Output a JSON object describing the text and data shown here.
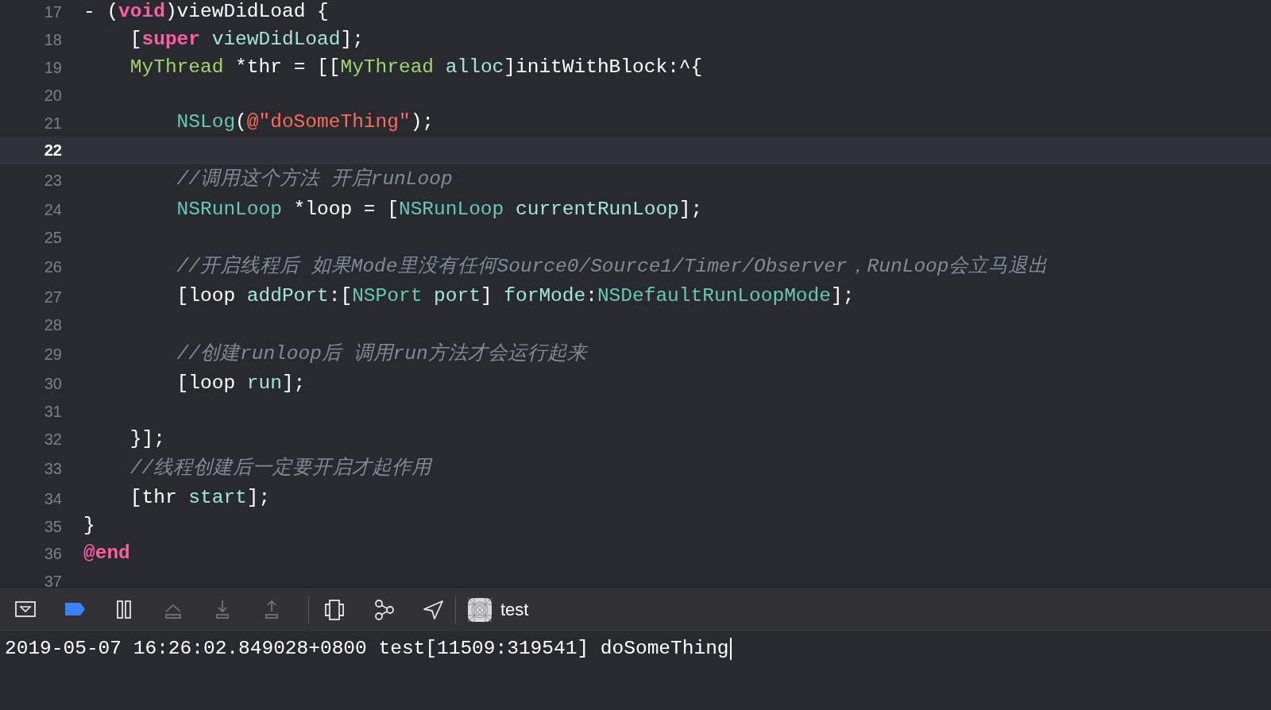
{
  "editor": {
    "lines": [
      {
        "number": "17",
        "current": false,
        "tokens": [
          {
            "text": "- (",
            "kind": "plain"
          },
          {
            "text": "void",
            "kind": "keyword"
          },
          {
            "text": ")viewDidLoad {",
            "kind": "plain"
          }
        ],
        "children": [
          {
            "number": "18",
            "current": false,
            "tokens": [
              {
                "text": "[",
                "kind": "plain"
              },
              {
                "text": "super",
                "kind": "keyword"
              },
              {
                "text": " viewDidLoad",
                "kind": "method"
              },
              {
                "text": "];",
                "kind": "plain"
              }
            ]
          },
          {
            "number": "19",
            "current": false,
            "tokens": [
              {
                "text": "MyThread",
                "kind": "class"
              },
              {
                "text": " *thr = [[",
                "kind": "plain"
              },
              {
                "text": "MyThread",
                "kind": "class"
              },
              {
                "text": " alloc",
                "kind": "method"
              },
              {
                "text": "]initWithBlock:^{",
                "kind": "plain"
              }
            ],
            "children": [
              {
                "number": "20",
                "current": false
              },
              {
                "number": "21",
                "current": false,
                "tokens": [
                  {
                    "text": "NSLog",
                    "kind": "system"
                  },
                  {
                    "text": "(",
                    "kind": "plain"
                  },
                  {
                    "text": "@\"doSomeThing\"",
                    "kind": "string"
                  },
                  {
                    "text": ");",
                    "kind": "plain"
                  }
                ]
              },
              {
                "number": "22",
                "current": true
              },
              {
                "number": "23",
                "current": false,
                "tokens": [
                  {
                    "text": "//调用这个方法 开启runLoop",
                    "kind": "comment"
                  }
                ]
              },
              {
                "number": "24",
                "current": false,
                "tokens": [
                  {
                    "text": "NSRunLoop",
                    "kind": "system"
                  },
                  {
                    "text": " *loop = [",
                    "kind": "plain"
                  },
                  {
                    "text": "NSRunLoop",
                    "kind": "system"
                  },
                  {
                    "text": " currentRunLoop",
                    "kind": "method"
                  },
                  {
                    "text": "];",
                    "kind": "plain"
                  }
                ]
              },
              {
                "number": "25",
                "current": false
              },
              {
                "number": "26",
                "current": false,
                "tokens": [
                  {
                    "text": "//开启线程后 如果Mode里没有任何Source0/Source1/Timer/Observer，RunLoop会立马退出",
                    "kind": "comment"
                  }
                ]
              },
              {
                "number": "27",
                "current": false,
                "tokens": [
                  {
                    "text": "[loop ",
                    "kind": "plain"
                  },
                  {
                    "text": "addPort",
                    "kind": "method"
                  },
                  {
                    "text": ":[",
                    "kind": "plain"
                  },
                  {
                    "text": "NSPort",
                    "kind": "system"
                  },
                  {
                    "text": " port",
                    "kind": "method"
                  },
                  {
                    "text": "] ",
                    "kind": "plain"
                  },
                  {
                    "text": "forMode",
                    "kind": "method"
                  },
                  {
                    "text": ":",
                    "kind": "plain"
                  },
                  {
                    "text": "NSDefaultRunLoopMode",
                    "kind": "system"
                  },
                  {
                    "text": "];",
                    "kind": "plain"
                  }
                ]
              },
              {
                "number": "28",
                "current": false
              },
              {
                "number": "29",
                "current": false,
                "tokens": [
                  {
                    "text": "//创建runloop后 调用run方法才会运行起来",
                    "kind": "comment"
                  }
                ]
              },
              {
                "number": "30",
                "current": false,
                "tokens": [
                  {
                    "text": "[loop ",
                    "kind": "plain"
                  },
                  {
                    "text": "run",
                    "kind": "method"
                  },
                  {
                    "text": "];",
                    "kind": "plain"
                  }
                ]
              },
              {
                "number": "31",
                "current": false
              }
            ]
          },
          {
            "number": "32",
            "current": false,
            "tokens": [
              {
                "text": "}];",
                "kind": "plain"
              }
            ]
          },
          {
            "number": "33",
            "current": false,
            "tokens": [
              {
                "text": "//线程创建后一定要开启才起作用",
                "kind": "comment"
              }
            ]
          },
          {
            "number": "34",
            "current": false,
            "tokens": [
              {
                "text": "[thr ",
                "kind": "plain"
              },
              {
                "text": "start",
                "kind": "method"
              },
              {
                "text": "];",
                "kind": "plain"
              }
            ]
          }
        ]
      },
      {
        "number": "35",
        "current": false,
        "tokens": [
          {
            "text": "}",
            "kind": "plain"
          }
        ]
      },
      {
        "number": "36",
        "current": false,
        "tokens": [
          {
            "text": "@end",
            "kind": "keyword"
          }
        ]
      },
      {
        "number": "37",
        "current": false
      }
    ]
  },
  "debug_bar": {
    "buttons": [
      {
        "kind": "hide-console",
        "disabled": false,
        "on": false
      },
      {
        "kind": "breakpoints",
        "disabled": false,
        "on": true
      },
      {
        "kind": "pause",
        "disabled": false,
        "on": false
      },
      {
        "kind": "step-over",
        "disabled": true,
        "on": false
      },
      {
        "kind": "step-into",
        "disabled": true,
        "on": false
      },
      {
        "kind": "step-out",
        "disabled": true,
        "on": false
      },
      {
        "kind": "view-debugger",
        "disabled": false,
        "on": false
      },
      {
        "kind": "memory-graph",
        "disabled": false,
        "on": false
      },
      {
        "kind": "location",
        "disabled": false,
        "on": false
      }
    ],
    "target": {
      "label": "test"
    }
  },
  "console": {
    "lines": [
      "2019-05-07 16:26:02.849028+0800 test[11509:319541] doSomeThing"
    ]
  }
}
